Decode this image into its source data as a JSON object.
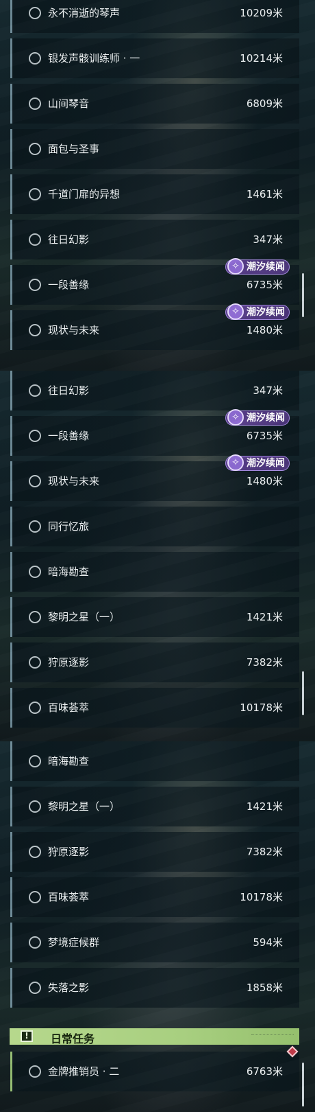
{
  "panel1": {
    "rows": [
      {
        "label": "永不消逝的琴声",
        "distance": "10209米"
      },
      {
        "label": "银发声骸训练师 · 一",
        "distance": "10214米"
      },
      {
        "label": "山间琴音",
        "distance": "6809米"
      },
      {
        "label": "面包与圣事",
        "distance": ""
      },
      {
        "label": "千道门扉的异想",
        "distance": "1461米"
      },
      {
        "label": "往日幻影",
        "distance": "347米"
      },
      {
        "label": "一段善缘",
        "distance": "6735米",
        "tag": "潮汐续闻"
      },
      {
        "label": "现状与未来",
        "distance": "1480米",
        "tag": "潮汐续闻"
      }
    ]
  },
  "panel2": {
    "rows": [
      {
        "label": "往日幻影",
        "distance": "347米"
      },
      {
        "label": "一段善缘",
        "distance": "6735米",
        "tag": "潮汐续闻"
      },
      {
        "label": "现状与未来",
        "distance": "1480米",
        "tag": "潮汐续闻"
      },
      {
        "label": "同行忆旅",
        "distance": ""
      },
      {
        "label": "暗海勘查",
        "distance": ""
      },
      {
        "label": "黎明之星（一）",
        "distance": "1421米"
      },
      {
        "label": "狩原逐影",
        "distance": "7382米"
      },
      {
        "label": "百味荟萃",
        "distance": "10178米"
      }
    ]
  },
  "panel3": {
    "rows": [
      {
        "label": "暗海勘查",
        "distance": ""
      },
      {
        "label": "黎明之星（一）",
        "distance": "1421米"
      },
      {
        "label": "狩原逐影",
        "distance": "7382米"
      },
      {
        "label": "百味荟萃",
        "distance": "10178米"
      },
      {
        "label": "梦境症候群",
        "distance": "594米"
      },
      {
        "label": "失落之影",
        "distance": "1858米"
      }
    ],
    "section_header": "日常任务",
    "section_icon": "exclamation-icon",
    "daily_rows": [
      {
        "label": "金牌推销员 · 二",
        "distance": "6763米"
      }
    ]
  },
  "icons": {
    "tag_icon": "tidal-swirl-icon",
    "row_icon": "circle-marker-icon",
    "badge": "red-diamond-icon"
  },
  "colors": {
    "tag_bg": "#5a3f8c",
    "daily_header": "#b6d88c",
    "row_border": "#6d8a96",
    "daily_border": "#94bd72",
    "badge": "#c03a48"
  }
}
